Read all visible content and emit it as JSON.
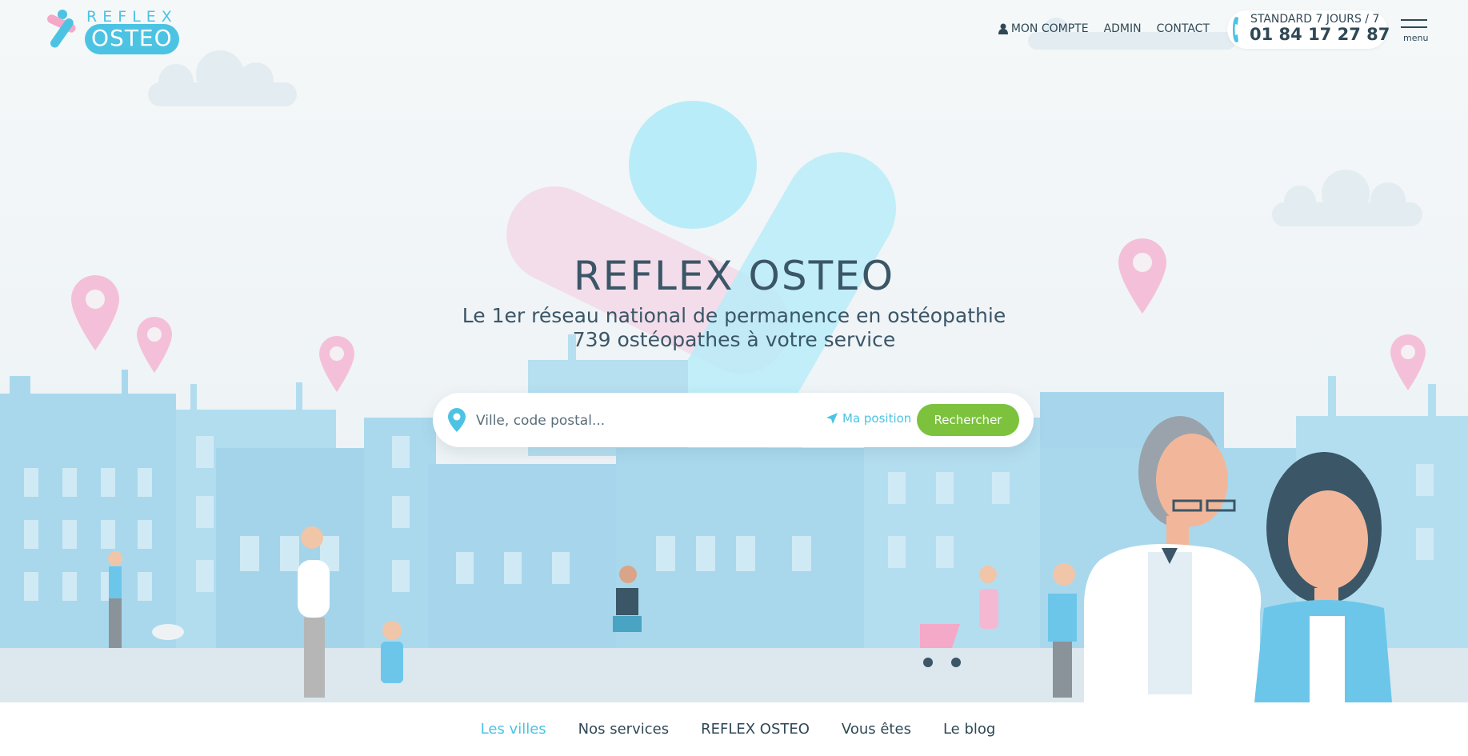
{
  "brand": {
    "logo_top": "REFLEX",
    "logo_bottom": "OSTEO",
    "accent_color": "#4cc3e3",
    "pink_color": "#f4a9c8",
    "green_color": "#7cc23d",
    "text_color": "#2f4856"
  },
  "header": {
    "account_label": "MON COMPTE",
    "admin_label": "ADMIN",
    "contact_label": "CONTACT",
    "phone_label": "STANDARD 7 JOURS / 7",
    "phone_number": "01 84 17 27 87",
    "menu_label": "menu",
    "icons": [
      "user-icon",
      "phone-icon",
      "hamburger-icon"
    ]
  },
  "hero": {
    "title": "REFLEX OSTEO",
    "subtitle_line1": "Le 1er réseau national de permanence en ostéopathie",
    "subtitle_line2": "739 ostéopathes à votre service"
  },
  "search": {
    "placeholder": "Ville, code postal...",
    "value": "",
    "geolocate_label": "Ma position",
    "submit_label": "Rechercher",
    "icons": [
      "location-pin-icon",
      "navigation-arrow-icon"
    ]
  },
  "bottom_nav": {
    "items": [
      {
        "label": "Les villes",
        "active": true
      },
      {
        "label": "Nos services",
        "active": false
      },
      {
        "label": "REFLEX OSTEO",
        "active": false
      },
      {
        "label": "Vous êtes",
        "active": false
      },
      {
        "label": "Le blog",
        "active": false
      }
    ]
  }
}
